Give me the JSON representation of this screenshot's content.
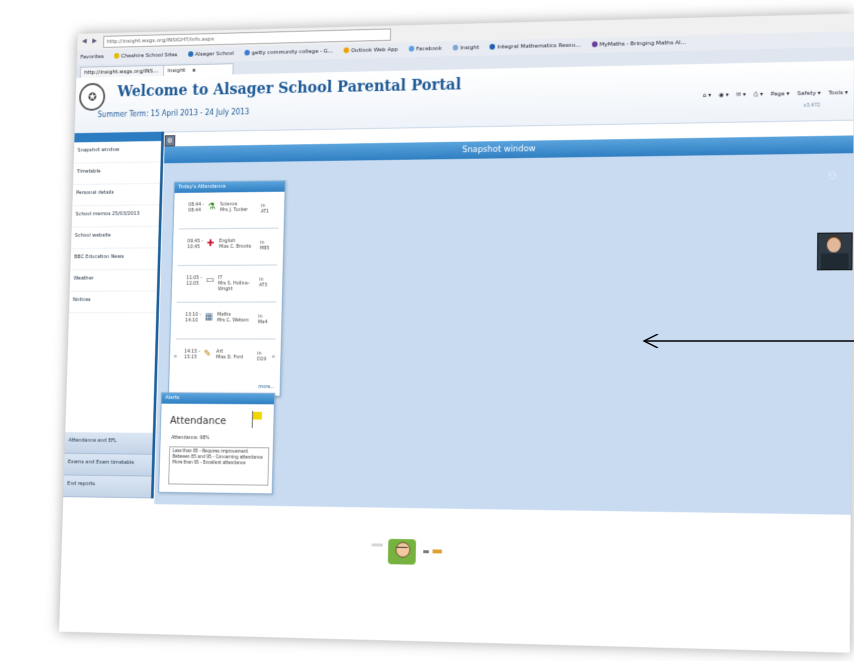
{
  "browser": {
    "address_url": "http://insight.wsgs.org/INSIGHT/Info.aspx",
    "favorites_label": "Favorites",
    "bookmarks": [
      "Cheshire School Sites",
      "Alsager School",
      "getty community college - G...",
      "Outlook Web App",
      "Facebook",
      "Insight",
      "Integral Mathematics Resou...",
      "MyMaths - Bringing Maths Al..."
    ],
    "tabs": [
      {
        "label": "http://insight.wsgs.org/INS..."
      },
      {
        "label": "Insight",
        "close": "x"
      }
    ],
    "tools": [
      "Page ▾",
      "Safety ▾",
      "Tools ▾"
    ]
  },
  "header": {
    "title": "Welcome to Alsager School Parental Portal",
    "term": "Summer Term: 15 April 2013 - 24 July 2013",
    "version": "v3.472"
  },
  "sidebar": {
    "items": [
      "Snapshot window",
      "Timetable",
      "Personal details",
      "School memos 25/03/2013",
      "School website",
      "BBC Education News",
      "Weather",
      "Notices"
    ],
    "bottom_items": [
      "Attendance and EFL",
      "Exams and Exam timetable",
      "End reports"
    ]
  },
  "main": {
    "snapshot_title": "Snapshot window"
  },
  "attendance": {
    "panel_title": "Today's Attendance",
    "lessons": [
      {
        "time": "08:44 - 08:44",
        "subject": "Science",
        "teacher": "Mrs J. Tucker",
        "room_label": "in",
        "room": "AT1"
      },
      {
        "time": "09:45 - 10:45",
        "subject": "English",
        "teacher": "Miss C. Brooks",
        "room_label": "in",
        "room": "M85"
      },
      {
        "time": "11:05 - 12:05",
        "subject": "IT",
        "teacher": "Mrs S. Hollins-Wright",
        "room_label": "in",
        "room": "AT3"
      },
      {
        "time": "13:10 - 14:10",
        "subject": "Maths",
        "teacher": "Mrs C. Watson",
        "room_label": "in",
        "room": "Ma4"
      },
      {
        "time": "14:15 - 15:15",
        "subject": "Art",
        "teacher": "Miss D. Ford",
        "room_label": "in",
        "room": "D19"
      }
    ],
    "more": "more..."
  },
  "alerts": {
    "panel_title": "Alerts",
    "title": "Attendance",
    "percent": "Attendance: 98%",
    "legend": [
      "Less than 85 - Requires improvement",
      "Between 85 and 95 - Concerning attendance",
      "More than 95 - Excellent attendance"
    ]
  },
  "icons": {
    "nav_back": "back-icon",
    "nav_forward": "forward-icon",
    "settings": "gear-icon",
    "snapshot": "people-icon",
    "flag": "flag-icon"
  },
  "colors": {
    "accent": "#2f7fc2",
    "header_text": "#1f5a96",
    "content_bg": "#c8dbf0",
    "flag": "#f1d600"
  }
}
